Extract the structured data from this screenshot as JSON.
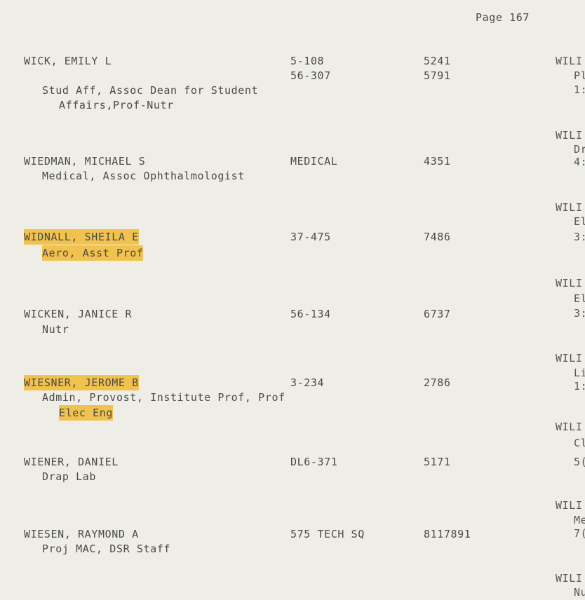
{
  "page_header": "Page 167",
  "entries": [
    {
      "name": "WICK, EMILY L",
      "rooms": [
        "5-108",
        "56-307"
      ],
      "phones": [
        "5241",
        "5791"
      ],
      "desc": [
        "Stud Aff, Assoc Dean for Student",
        "Affairs,Prof-Nutr"
      ]
    },
    {
      "name": "WIEDMAN, MICHAEL S",
      "rooms": [
        "MEDICAL"
      ],
      "phones": [
        "4351"
      ],
      "desc": [
        "Medical, Assoc Ophthalmologist"
      ]
    },
    {
      "name": "WIDNALL, SHEILA E",
      "rooms": [
        "37-475"
      ],
      "phones": [
        "7486"
      ],
      "desc": [
        "Aero, Asst Prof"
      ]
    },
    {
      "name": "WICKEN, JANICE R",
      "rooms": [
        "56-134"
      ],
      "phones": [
        "6737"
      ],
      "desc": [
        "Nutr"
      ]
    },
    {
      "name": "WIESNER, JEROME B",
      "rooms": [
        "3-234"
      ],
      "phones": [
        "2786"
      ],
      "desc": [
        "Admin, Provost, Institute Prof, Prof",
        "Elec Eng"
      ]
    },
    {
      "name": "WIENER, DANIEL",
      "rooms": [
        "DL6-371"
      ],
      "phones": [
        "5171"
      ],
      "desc": [
        "Drap Lab"
      ]
    },
    {
      "name": "WIESEN, RAYMOND A",
      "rooms": [
        "575 TECH SQ"
      ],
      "phones": [
        "8117891"
      ],
      "desc": [
        "Proj MAC, DSR Staff"
      ]
    }
  ],
  "right_column": [
    {
      "lines": [
        "WILI",
        "Pl",
        "1:"
      ]
    },
    {
      "lines": [
        "WILI",
        "Dr",
        "4:"
      ]
    },
    {
      "lines": [
        "WILI",
        "El",
        "3:"
      ]
    },
    {
      "lines": [
        "WILI",
        "El",
        "3:"
      ]
    },
    {
      "lines": [
        "WILI",
        "Li",
        "1:"
      ]
    },
    {
      "lines": [
        "WILI",
        "Cl",
        "5("
      ]
    },
    {
      "lines": [
        "WILI",
        "Me",
        "7("
      ]
    },
    {
      "lines": [
        "WILI",
        "Nu"
      ]
    }
  ],
  "highlight_color": "#f2c24e"
}
